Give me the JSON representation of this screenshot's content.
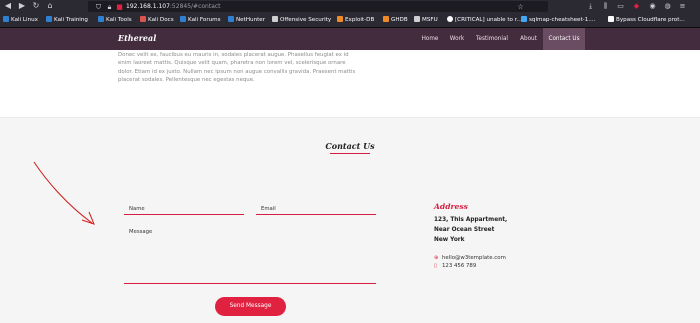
{
  "browser": {
    "url_host": "192.168.1.107",
    "url_rest": ":52845/#contact",
    "bookmarks": [
      {
        "label": "Kali Linux",
        "icon": "kali-icon",
        "color": "#2f80d1"
      },
      {
        "label": "Kali Training",
        "icon": "kali-icon",
        "color": "#2f80d1"
      },
      {
        "label": "Kali Tools",
        "icon": "kali-icon",
        "color": "#2f80d1"
      },
      {
        "label": "Kali Docs",
        "icon": "kali-docs-icon",
        "color": "#d9534f"
      },
      {
        "label": "Kali Forums",
        "icon": "kali-icon",
        "color": "#2f80d1"
      },
      {
        "label": "NetHunter",
        "icon": "kali-icon",
        "color": "#2f80d1"
      },
      {
        "label": "Offensive Security",
        "icon": "offsec-icon",
        "color": "#cfcfcf"
      },
      {
        "label": "Exploit-DB",
        "icon": "exploitdb-icon",
        "color": "#f08a24"
      },
      {
        "label": "GHDB",
        "icon": "ghdb-icon",
        "color": "#f08a24"
      },
      {
        "label": "MSFU",
        "icon": "msfu-icon",
        "color": "#cfcfcf"
      },
      {
        "label": "[CRITICAL] unable to r...",
        "icon": "github-icon",
        "color": "#fbfbfe"
      },
      {
        "label": "sqlmap-cheatsheet-1....",
        "icon": "file-icon",
        "color": "#3fa9f5"
      },
      {
        "label": "Bypass Cloudflare prot...",
        "icon": "cloudflare-icon",
        "color": "#fbfbfe"
      }
    ]
  },
  "site": {
    "brand": "Ethereal",
    "nav": [
      "Home",
      "Work",
      "Testimonial",
      "About",
      "Contact Us"
    ]
  },
  "about": {
    "text": "Donec velit ex, faucibus eu mauris in, sodales placerat augue. Phasellus feugiat ex id enim laoreet mattis. Quisque velit quam, pharetra non lorem vel, scelerisque ornare dolor. Etiam id ex justo. Nullam nec ipsum non augue convallis gravida. Praesent mattis placerat sodales. Pellentesque nec egestas neque."
  },
  "contact": {
    "title": "Contact Us",
    "name_label": "Name",
    "email_label": "Email",
    "message_label": "Message",
    "send_label": "Send Message",
    "address_title": "Address",
    "address_lines": [
      "123, This Appartment,",
      "Near Ocean Street",
      "New York"
    ],
    "email": "hello@w3template.com",
    "phone": "123 456 789"
  },
  "colors": {
    "accent": "#d71d3f",
    "nav_bg": "#442c3f",
    "nav_active": "#6a4c63"
  }
}
